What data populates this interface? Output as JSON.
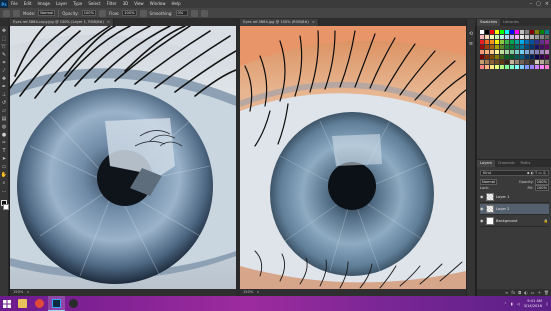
{
  "app": {
    "logo": "Ps",
    "menu": [
      "File",
      "Edit",
      "Image",
      "Layer",
      "Type",
      "Select",
      "Filter",
      "3D",
      "View",
      "Window",
      "Help"
    ]
  },
  "options_bar": {
    "mode_label": "Mode:",
    "mode_value": "Normal",
    "opacity_label": "Opacity:",
    "opacity_value": "100%",
    "flow_label": "Flow:",
    "flow_value": "100%",
    "smoothing_label": "Smoothing:",
    "smoothing_value": "0%"
  },
  "tabs": [
    {
      "label": "Eyes ref-5864-copy.jpg @ 150% (Layer 1, RGB/8#)",
      "close": "×"
    },
    {
      "label": "Eyes ref-5864.jpg @ 150% (RGB/8#)",
      "close": "×"
    }
  ],
  "status": {
    "left": "150%",
    "right": "150%",
    "arrow": "▸"
  },
  "swatches_panel": {
    "tabs": [
      "Swatches",
      "Libraries"
    ],
    "colors": [
      "#ffffff",
      "#000000",
      "#ff0000",
      "#ffff00",
      "#00ff00",
      "#00ffff",
      "#0000ff",
      "#ff00ff",
      "#c0c0c0",
      "#808080",
      "#800000",
      "#808000",
      "#008000",
      "#008080",
      "#f7b3b3",
      "#f7d9b3",
      "#f7f7b3",
      "#c9f7b3",
      "#b3f7e1",
      "#b3d9f7",
      "#c0b3f7",
      "#f0b3f7",
      "#e6e6e6",
      "#cccccc",
      "#b3b3b3",
      "#999999",
      "#808080",
      "#666666",
      "#ed1c24",
      "#f26522",
      "#f7941d",
      "#fff200",
      "#8dc63f",
      "#39b54a",
      "#00a651",
      "#00a99d",
      "#00aeef",
      "#0072bc",
      "#0054a6",
      "#2e3192",
      "#662d91",
      "#92278f",
      "#9e0b0f",
      "#a0410d",
      "#a36209",
      "#aba000",
      "#598527",
      "#1a7b30",
      "#007236",
      "#00746b",
      "#0076a3",
      "#004a80",
      "#003471",
      "#1b1464",
      "#440e62",
      "#630460",
      "#f69679",
      "#f9ad81",
      "#fdc689",
      "#fff799",
      "#c4df9b",
      "#a3d39c",
      "#82ca9c",
      "#7accc8",
      "#6dcff6",
      "#7da7d9",
      "#8393ca",
      "#8781bd",
      "#a186be",
      "#bd8cbf",
      "#790000",
      "#7b2e00",
      "#7d4900",
      "#827b00",
      "#406618",
      "#005e20",
      "#005826",
      "#005952",
      "#005b7f",
      "#003663",
      "#002157",
      "#0d004c",
      "#32004b",
      "#4b0049",
      "#c69c6d",
      "#a67c52",
      "#8c6239",
      "#754c24",
      "#603913",
      "#3c2415",
      "#c7b299",
      "#998675",
      "#736357",
      "#534741",
      "#362f2d",
      "#d2c8bc",
      "#b5a898",
      "#8a7e72",
      "#ff8080",
      "#ffb380",
      "#ffe680",
      "#e6ff80",
      "#b3ff80",
      "#80ff99",
      "#80ffcc",
      "#80ffff",
      "#80ccff",
      "#8099ff",
      "#9980ff",
      "#cc80ff",
      "#ff80ff",
      "#ff80cc"
    ]
  },
  "layers_panel": {
    "tabs": [
      "Layers",
      "Channels",
      "Paths"
    ],
    "search_label": "Kind",
    "blend_mode": "Normal",
    "opacity_label": "Opacity:",
    "opacity_value": "100%",
    "lock_label": "Lock:",
    "fill_label": "Fill:",
    "fill_value": "100%",
    "layers": [
      {
        "name": "Layer 1",
        "active": false,
        "checker": true
      },
      {
        "name": "Layer 2",
        "active": true,
        "checker": true
      },
      {
        "name": "Background",
        "active": false,
        "checker": false,
        "locked": true
      }
    ]
  },
  "taskbar": {
    "time": "9:41 AM",
    "date": "3/14/2016",
    "apps": [
      {
        "name": "file-explorer",
        "color": "#e8c25a"
      },
      {
        "name": "chrome",
        "color": "#e04a3b"
      },
      {
        "name": "photoshop",
        "color": "#0c2a44"
      },
      {
        "name": "obs",
        "color": "#2b2b2b"
      }
    ]
  }
}
